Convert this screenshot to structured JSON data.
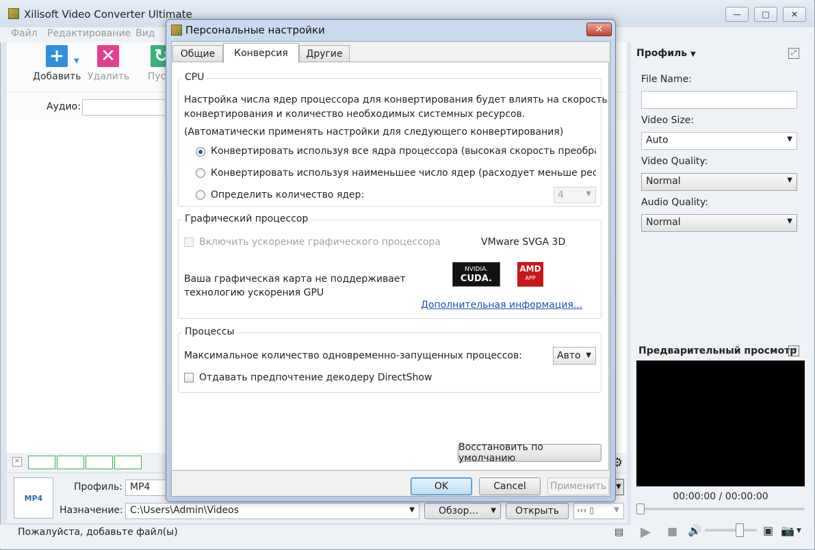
{
  "app": {
    "title": "Xilisoft Video Converter Ultimate",
    "window_buttons": {
      "minimize": "—",
      "maximize": "□",
      "close": "✕"
    }
  },
  "menu": [
    "Файл",
    "Редактирование",
    "Вид"
  ],
  "toolbar": {
    "add_label": "Добавить",
    "delete_label": "Удалить",
    "start_label": "Пус"
  },
  "filter": {
    "audio_label": "Аудио:"
  },
  "bottom": {
    "profile_label": "Профиль:",
    "profile_value": "MP4",
    "destination_label": "Назначение:",
    "destination_value": "C:\\Users\\Admin\\Videos",
    "browse_label": "Обзор...",
    "open_label": "Открыть",
    "mp4_icon": "MP4"
  },
  "status": {
    "text": "Пожалуйста, добавьте файл(ы)"
  },
  "right_panel": {
    "profile_header": "Профиль",
    "file_name_label": "File Name:",
    "file_name_value": "",
    "video_size_label": "Video Size:",
    "video_size_value": "Auto",
    "video_quality_label": "Video Quality:",
    "video_quality_value": "Normal",
    "audio_quality_label": "Audio Quality:",
    "audio_quality_value": "Normal",
    "preview_header": "Предварительный просмотр",
    "timecode": "00:00:00 / 00:00:00"
  },
  "dialog": {
    "title": "Персональные настройки",
    "tabs": [
      {
        "label": "Общие",
        "active": false
      },
      {
        "label": "Конверсия",
        "active": true
      },
      {
        "label": "Другие",
        "active": false
      }
    ],
    "cpu": {
      "title": "CPU",
      "desc_line1": "Настройка числа ядер процессора для конвертирования будет влиять на скорость",
      "desc_line2": "конвертирования и количество необходимых системных ресурсов.",
      "auto_note": "(Автоматически применять настройки для следующего конвертирования)",
      "option_all": "Конвертировать используя все ядра процессора (высокая скорость преобразов",
      "option_min": "Конвертировать используя наименьшее число ядер (расходует меньше ресурсс",
      "option_custom": "Определить количество ядер:",
      "cores_value": "4",
      "selected": "all"
    },
    "gpu": {
      "title": "Графический процессор",
      "enable_label": "Включить ускорение графического процессора",
      "adapter": "VMware SVGA 3D",
      "unsupported_line1": "Ваша графическая карта не поддерживает",
      "unsupported_line2": "технологию ускорения GPU",
      "nvidia_logo": "NVIDIA.",
      "cuda_logo": "CUDA.",
      "amd_logo": "AMD",
      "app_logo": "APP",
      "more_info": "Дополнительная информация..."
    },
    "processes": {
      "title": "Процессы",
      "max_label": "Максимальное количество одновременно-запущенных процессов:",
      "max_value": "Авто",
      "directshow_label": "Отдавать предпочтение декодеру DirectShow"
    },
    "restore_label": "Восстановить по умолчанию",
    "ok_label": "OK",
    "cancel_label": "Cancel",
    "apply_label": "Применить"
  }
}
